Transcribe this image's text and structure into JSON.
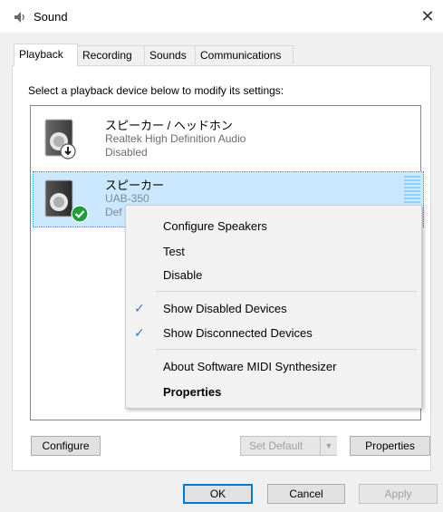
{
  "window": {
    "title": "Sound",
    "close_glyph": "✕"
  },
  "tabs": [
    {
      "label": "Playback",
      "active": true
    },
    {
      "label": "Recording"
    },
    {
      "label": "Sounds"
    },
    {
      "label": "Communications"
    }
  ],
  "instruction": "Select a playback device below to modify its settings:",
  "devices": [
    {
      "name": "スピーカー / ヘッドホン",
      "driver": "Realtek High Definition Audio",
      "status": "Disabled",
      "badge_icon": "down-arrow-icon"
    },
    {
      "name": "スピーカー",
      "driver": "UAB-350",
      "status": "Def",
      "badge_icon": "checkmark-icon",
      "selected": true
    }
  ],
  "context_menu": {
    "items": [
      {
        "label": "Configure Speakers"
      },
      {
        "label": "Test"
      },
      {
        "label": "Disable"
      },
      {
        "label": "Show Disabled Devices",
        "checked": true
      },
      {
        "label": "Show Disconnected Devices",
        "checked": true
      },
      {
        "label": "About Software MIDI Synthesizer"
      },
      {
        "label": "Properties",
        "bold": true
      }
    ],
    "check_glyph": "✓"
  },
  "panel_buttons": {
    "configure": "Configure",
    "set_default": "Set Default",
    "split_arrow": "▼",
    "properties": "Properties"
  },
  "dialog_buttons": {
    "ok": "OK",
    "cancel": "Cancel",
    "apply": "Apply"
  },
  "colors": {
    "selection_bg": "#cce8ff",
    "selection_border": "#26a0da",
    "check_blue": "#3a78c9",
    "badge_green": "#1e9e3a"
  }
}
